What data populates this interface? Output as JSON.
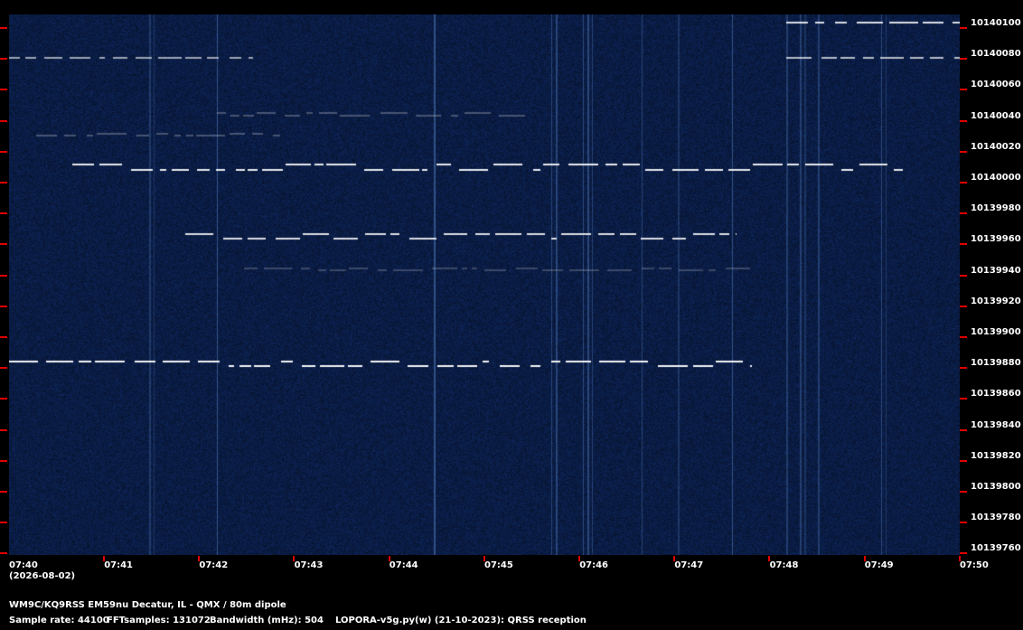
{
  "chart_data": {
    "type": "heatmap",
    "ylabels": [
      "10140100",
      "10140080",
      "10140060",
      "10140040",
      "10140020",
      "10140000",
      "10139980",
      "10139960",
      "10139940",
      "10139920",
      "10139900",
      "10139880",
      "10139860",
      "10139840",
      "10139820",
      "10139800",
      "10139780",
      "10139760"
    ],
    "xlabels": [
      "07:40",
      "07:41",
      "07:42",
      "07:43",
      "07:44",
      "07:45",
      "07:46",
      "07:47",
      "07:48",
      "07:49",
      "07:50"
    ],
    "date": "(2026-08-02)",
    "colors": {
      "background": "#0f2552",
      "signal": "#ffffff",
      "tick": "#e00000"
    }
  },
  "footer": {
    "station": "WM9C/KQ9RSS EM59nu Decatur, IL - QMX / 80m dipole",
    "sample_rate": "Sample rate: 44100",
    "fft_samples": "FFTsamples: 131072",
    "bandwidth": "Bandwidth (mHz): 504",
    "software": "LOPORA-v5g.py(w) (21-10-2023): QRSS reception"
  }
}
